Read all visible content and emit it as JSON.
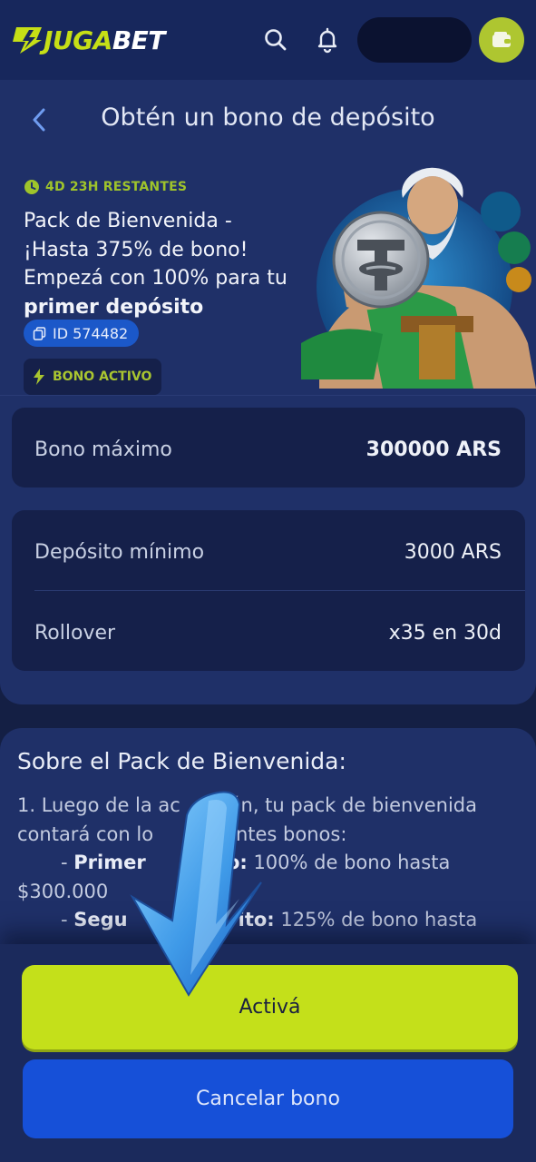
{
  "header": {
    "logo_part1": "JUGA",
    "logo_part2": "BET",
    "icons": [
      "search-icon",
      "bell-icon",
      "wallet-icon"
    ],
    "accent_color": "#c6df16"
  },
  "page": {
    "title": "Obtén un bono de depósito",
    "back_icon": "chevron-left-icon"
  },
  "bonus": {
    "time_remaining": "4D 23H RESTANTES",
    "title_line1": "Pack de Bienvenida -",
    "title_line2": "¡Hasta 375% de bono!",
    "title_line3": "Empezá con 100% para tu",
    "title_bold": "primer depósito",
    "id_label": "ID 574482",
    "status": "BONO ACTIVO"
  },
  "details": {
    "max_bonus_label": "Bono máximo",
    "max_bonus_value": "300000 ARS",
    "min_deposit_label": "Depósito mínimo",
    "min_deposit_value": "3000 ARS",
    "rollover_label": "Rollover",
    "rollover_value": "x35 en 30d"
  },
  "about": {
    "title": "Sobre el Pack de Bienvenida:",
    "p1_a": "1. Luego de la ac",
    "p1_b": "ión, tu pack de bienvenida",
    "p2_a": "contará con lo",
    "p2_b": "entes bonos:",
    "item1_bold": "Primer",
    "item1_bold_tail": "ito:",
    "item1_text": " 100% de bono hasta",
    "item1_amount": "$300.000",
    "item2_bold": "Segu",
    "item2_bold_tail": "ito:",
    "item2_text": " 125% de bono hasta"
  },
  "actions": {
    "activate": "Activá",
    "cancel": "Cancelar bono"
  }
}
